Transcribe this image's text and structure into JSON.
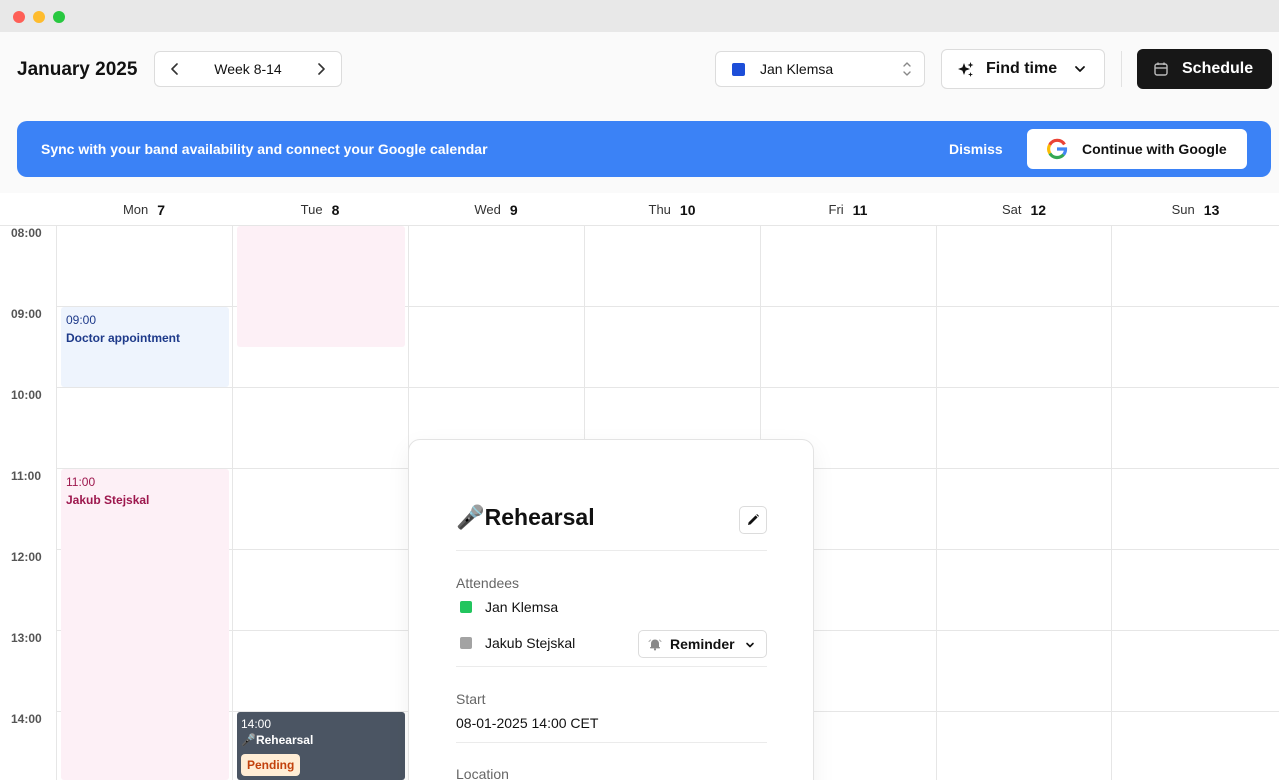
{
  "header": {
    "month_title": "January 2025",
    "week_label": "Week 8-14",
    "user_select": {
      "name": "Jan Klemsa",
      "swatch_color": "#1d4ed8"
    },
    "find_time_label": "Find time",
    "schedule_label": "Schedule"
  },
  "banner": {
    "text": "Sync with your band availability and connect your Google calendar",
    "dismiss_label": "Dismiss",
    "google_label": "Continue with Google",
    "color": "#3b82f6"
  },
  "days": [
    {
      "name": "Mon",
      "num": "7"
    },
    {
      "name": "Tue",
      "num": "8"
    },
    {
      "name": "Wed",
      "num": "9"
    },
    {
      "name": "Thu",
      "num": "10"
    },
    {
      "name": "Fri",
      "num": "11"
    },
    {
      "name": "Sat",
      "num": "12"
    },
    {
      "name": "Sun",
      "num": "13"
    }
  ],
  "times": [
    "08:00",
    "09:00",
    "10:00",
    "11:00",
    "12:00",
    "13:00",
    "14:00"
  ],
  "events": {
    "doctor": {
      "time": "09:00",
      "title": "Doctor appointment"
    },
    "jakub": {
      "time": "11:00",
      "title": "Jakub Stejskal"
    },
    "rehearsal": {
      "time": "14:00",
      "title": "🎤Rehearsal",
      "status": "Pending"
    }
  },
  "popover": {
    "title": "🎤Rehearsal",
    "attendees_label": "Attendees",
    "attendees": [
      {
        "name": "Jan Klemsa",
        "color": "#22c55e"
      },
      {
        "name": "Jakub Stejskal",
        "color": "#a3a3a3"
      }
    ],
    "reminder_label": "Reminder",
    "start_label": "Start",
    "start_value": "08-01-2025 14:00 CET",
    "location_label": "Location"
  }
}
